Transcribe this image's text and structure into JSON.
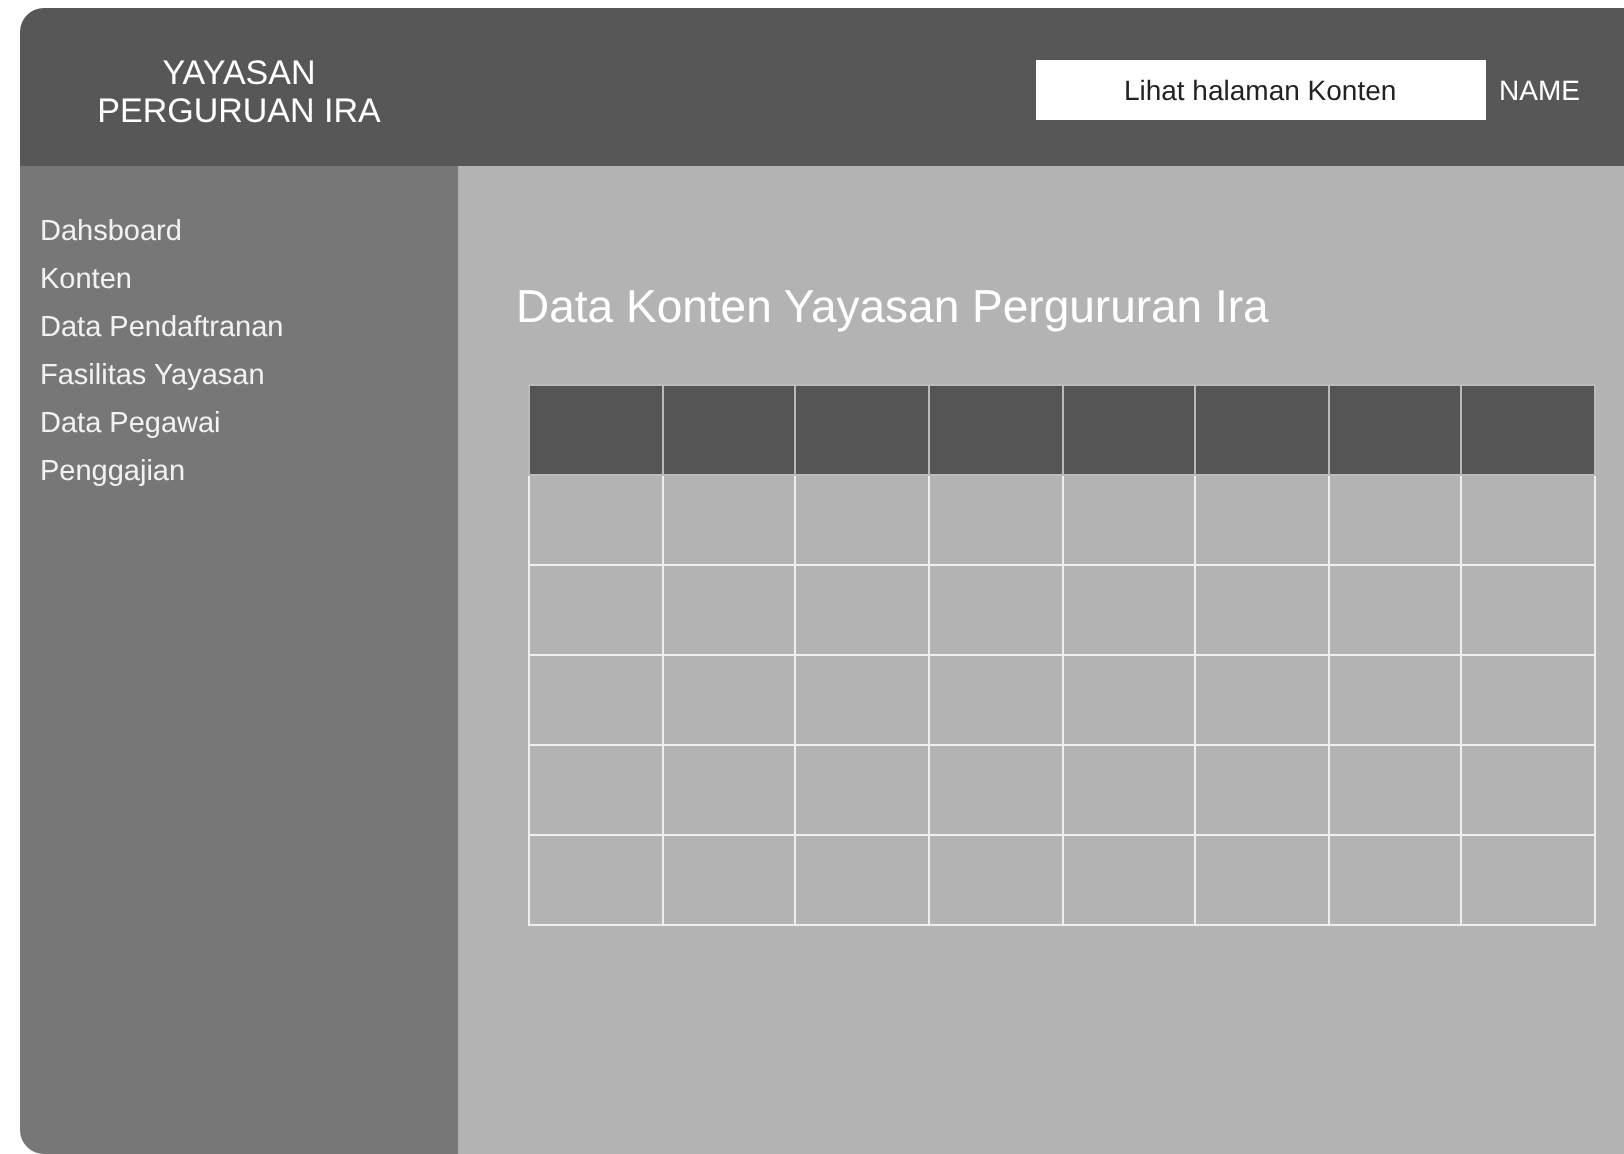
{
  "header": {
    "logo_lines": [
      "YAYASAN",
      "PERGURUAN IRA"
    ],
    "view_button": "Lihat halaman Konten",
    "user_name": "NAME"
  },
  "sidebar": {
    "items": [
      {
        "label": "Dahsboard"
      },
      {
        "label": "Konten"
      },
      {
        "label": "Data Pendaftranan"
      },
      {
        "label": "Fasilitas Yayasan"
      },
      {
        "label": "Data Pegawai"
      },
      {
        "label": "Penggajian"
      }
    ]
  },
  "main": {
    "title": "Data Konten Yayasan Pergururan Ira",
    "table": {
      "columns": [
        {
          "kind": "empty"
        },
        {
          "kind": "empty"
        },
        {
          "kind": "empty"
        },
        {
          "kind": "empty"
        },
        {
          "kind": "empty"
        },
        {
          "kind": "empty"
        },
        {
          "kind": "empty"
        },
        {
          "kind": "empty"
        }
      ],
      "rows": [
        {
          "kind": "empty"
        },
        {
          "kind": "empty"
        },
        {
          "kind": "empty"
        },
        {
          "kind": "empty"
        },
        {
          "kind": "empty"
        }
      ]
    }
  }
}
